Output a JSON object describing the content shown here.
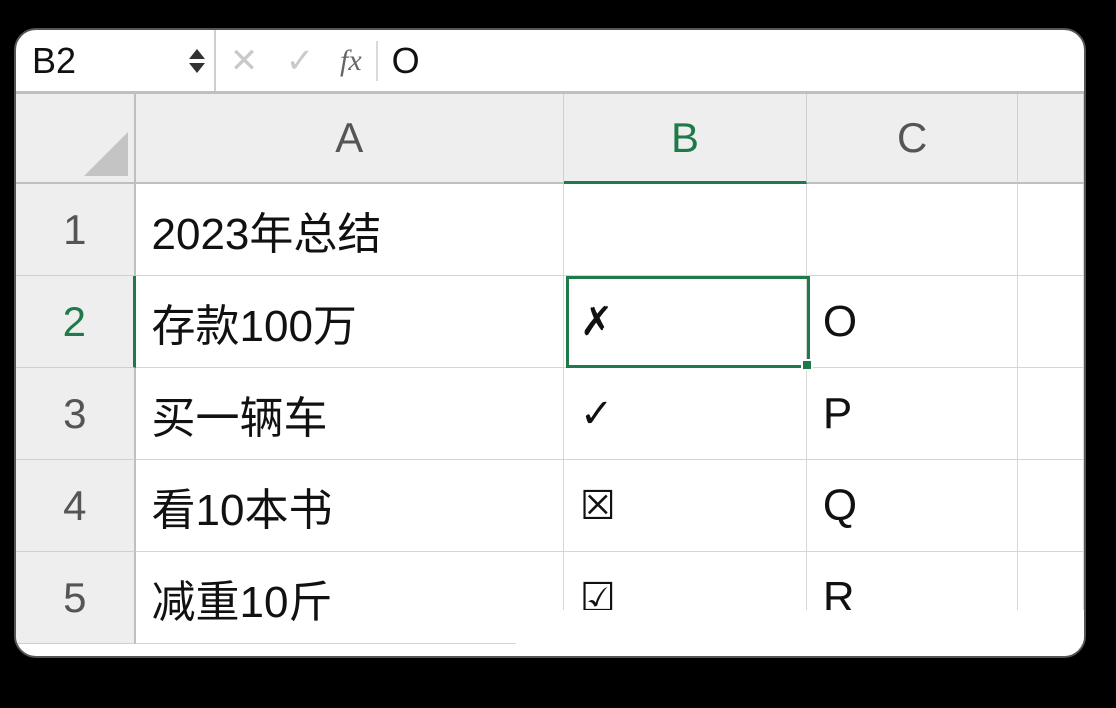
{
  "formula_bar": {
    "namebox_value": "B2",
    "fx_label": "fx",
    "formula_value": "O"
  },
  "columns": [
    "A",
    "B",
    "C"
  ],
  "active_column_index": 1,
  "rows": [
    "1",
    "2",
    "3",
    "4",
    "5"
  ],
  "active_row_index": 1,
  "cells": {
    "A1": "2023年总结",
    "A2": "存款100万",
    "A3": "买一辆车",
    "A4": "看10本书",
    "A5": "减重10斤",
    "B2": "✗",
    "B3": "✓",
    "B4": "☒",
    "B5": "☑",
    "C2": "O",
    "C3": "P",
    "C4": "Q",
    "C5": "R"
  },
  "selected_cell": "B2"
}
